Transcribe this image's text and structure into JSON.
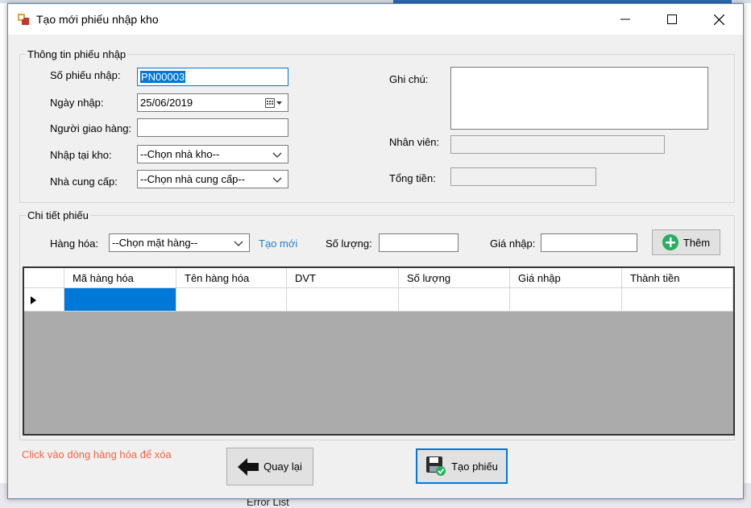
{
  "window": {
    "title": "Tạo mới phiếu nhập kho"
  },
  "background": {
    "bottom_text": "Error List"
  },
  "info_group": {
    "caption": "Thông tin phiếu nhập",
    "so_phieu_label": "Số phiếu nhập:",
    "so_phieu_value": "PN00003",
    "ngay_nhap_label": "Ngày nhập:",
    "ngay_nhap_value": "25/06/2019",
    "nguoi_giao_label": "Người giao hàng:",
    "nguoi_giao_value": "",
    "kho_label": "Nhập tại kho:",
    "kho_value": "--Chọn nhà kho--",
    "ncc_label": "Nhà cung cấp:",
    "ncc_value": "--Chọn nhà cung cấp--",
    "ghi_chu_label": "Ghi chú:",
    "ghi_chu_value": "",
    "nhan_vien_label": "Nhân viên:",
    "nhan_vien_value": "",
    "tong_tien_label": "Tổng tiền:",
    "tong_tien_value": ""
  },
  "detail_group": {
    "caption": "Chi tiết phiếu",
    "hang_hoa_label": "Hàng hóa:",
    "hang_hoa_value": "--Chọn mặt hàng--",
    "tao_moi_link": "Tạo mới",
    "so_luong_label": "Số lượng:",
    "so_luong_value": "",
    "gia_nhap_label": "Giá nhập:",
    "gia_nhap_value": "",
    "them_button": "Thêm"
  },
  "grid": {
    "columns": [
      "Mã hàng hóa",
      "Tên hàng hóa",
      "DVT",
      "Số lượng",
      "Giá nhập",
      "Thành tiền"
    ]
  },
  "footer": {
    "hint": "Click vào dòng hàng hóa để xóa",
    "quay_lai_button": "Quay lại",
    "tao_phieu_button": "Tạo phiếu"
  },
  "colors": {
    "accent": "#0078d7",
    "hint": "#f06548",
    "link": "#1e7fd8",
    "grid_bg": "#ababab",
    "add_icon": "#27ae60"
  },
  "icons": [
    "app-icon",
    "minimize-icon",
    "maximize-icon",
    "close-icon",
    "calendar-icon",
    "chevron-down-icon",
    "add-circle-icon",
    "back-arrow-icon",
    "save-icon",
    "row-selector-icon"
  ]
}
